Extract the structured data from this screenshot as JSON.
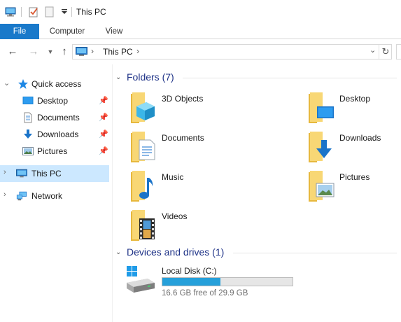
{
  "window": {
    "title": "This PC"
  },
  "ribbon": {
    "tabs": [
      "File",
      "Computer",
      "View"
    ]
  },
  "address": {
    "path_segment": "This PC"
  },
  "sidebar": {
    "quick_access": "Quick access",
    "pinned": [
      {
        "label": "Desktop",
        "icon": "desktop-icon"
      },
      {
        "label": "Documents",
        "icon": "documents-icon"
      },
      {
        "label": "Downloads",
        "icon": "downloads-icon"
      },
      {
        "label": "Pictures",
        "icon": "pictures-icon"
      }
    ],
    "this_pc": "This PC",
    "network": "Network"
  },
  "folders": {
    "header": "Folders (7)",
    "items": [
      {
        "label": "3D Objects",
        "icon": "3d-objects-icon"
      },
      {
        "label": "Desktop",
        "icon": "desktop-folder-icon"
      },
      {
        "label": "Documents",
        "icon": "documents-folder-icon"
      },
      {
        "label": "Downloads",
        "icon": "downloads-folder-icon"
      },
      {
        "label": "Music",
        "icon": "music-folder-icon"
      },
      {
        "label": "Pictures",
        "icon": "pictures-folder-icon"
      },
      {
        "label": "Videos",
        "icon": "videos-folder-icon"
      }
    ]
  },
  "devices": {
    "header": "Devices and drives (1)",
    "drives": [
      {
        "name": "Local Disk (C:)",
        "free_text": "16.6 GB free of 29.9 GB",
        "used_fraction": 0.445
      }
    ]
  },
  "colors": {
    "accent": "#1979ca",
    "folder": "#f8d775",
    "selection": "#cce8ff",
    "drive_fill": "#26a0da",
    "group_header": "#1e3287"
  }
}
